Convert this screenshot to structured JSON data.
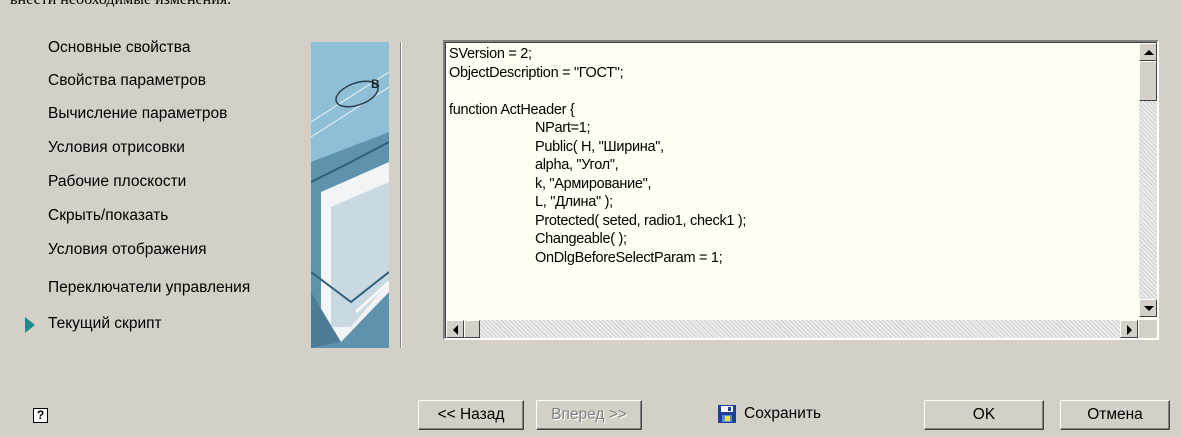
{
  "top_text": "внести необходимые изменения.",
  "nav": {
    "items": [
      {
        "label": "Основные свойства"
      },
      {
        "label": "Свойства параметров"
      },
      {
        "label": "Вычисление параметров"
      },
      {
        "label": "Условия отрисовки"
      },
      {
        "label": "Рабочие плоскости"
      },
      {
        "label": "Скрыть/показать"
      },
      {
        "label": "Условия отображения"
      },
      {
        "label": "Переключатели управления"
      },
      {
        "label": "Текущий скрипт",
        "active": true
      }
    ]
  },
  "banner": {
    "badge_text": "B"
  },
  "editor": {
    "lines": [
      {
        "text": "SVersion = 2;",
        "indent": false
      },
      {
        "text": "ObjectDescription = \"ГОСТ\";",
        "indent": false
      },
      {
        "text": "",
        "indent": false
      },
      {
        "text": "function ActHeader {",
        "indent": false
      },
      {
        "text": "NPart=1;",
        "indent": true
      },
      {
        "text": "Public( H, \"Ширина\",",
        "indent": true
      },
      {
        "text": "alpha, \"Угол\",",
        "indent": true
      },
      {
        "text": "k, \"Армирование\",",
        "indent": true
      },
      {
        "text": "L, \"Длина\" );",
        "indent": true
      },
      {
        "text": "Protected( seted, radio1, check1 );",
        "indent": true
      },
      {
        "text": "Changeable( );",
        "indent": true
      },
      {
        "text": "OnDlgBeforeSelectParam = 1;",
        "indent": true
      }
    ]
  },
  "footer": {
    "help_icon_text": "?",
    "back_label": "<< Назад",
    "next_label": "Вперед >>",
    "save_label": "Сохранить",
    "ok_label": "OK",
    "cancel_label": "Отмена"
  },
  "colors": {
    "background": "#d4d0c8",
    "editor_background": "#fefef2",
    "active_arrow": "#1f8a8a"
  }
}
